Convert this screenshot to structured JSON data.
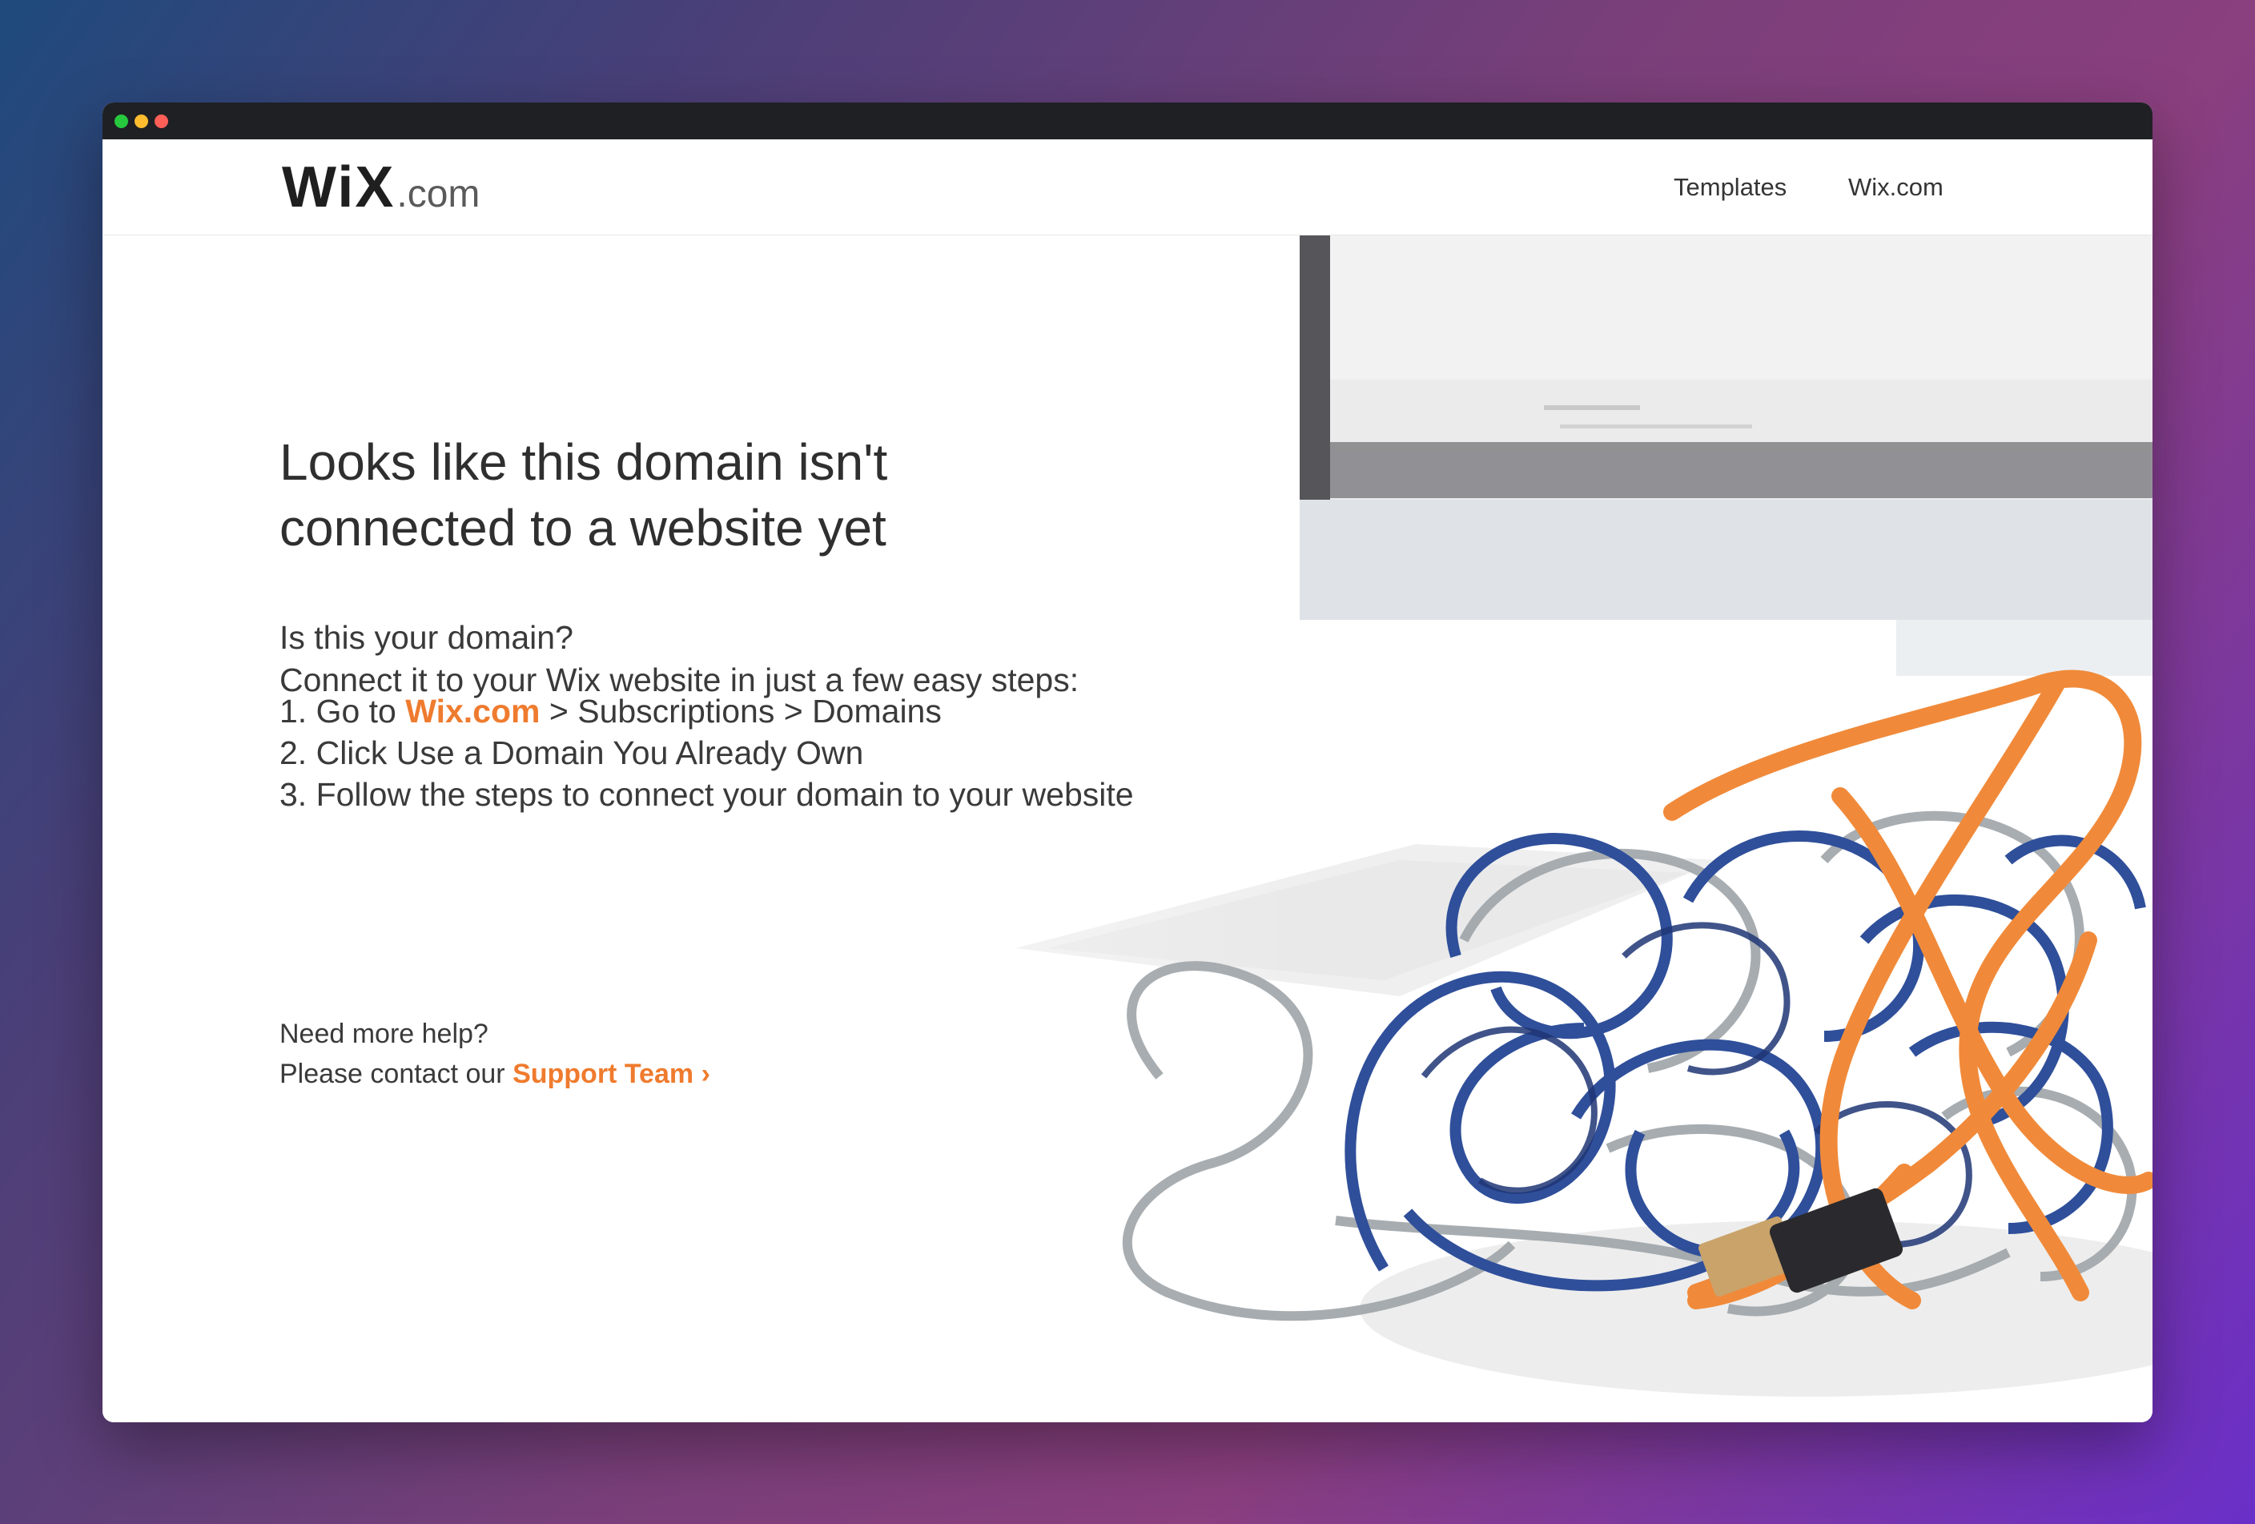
{
  "window": {
    "controls": [
      "green",
      "yellow",
      "red"
    ]
  },
  "header": {
    "logo_wordmark": "WiX",
    "logo_suffix": ".com",
    "nav": [
      {
        "label": "Templates"
      },
      {
        "label": "Wix.com"
      }
    ]
  },
  "main": {
    "headline_line1": "Looks like this domain isn't",
    "headline_line2": "connected to a website yet",
    "intro_line1": "Is this your domain?",
    "intro_line2": "Connect it to your Wix website in just a few easy steps:",
    "step1_prefix": "1. Go to ",
    "step1_link": "Wix.com",
    "step1_suffix": " > Subscriptions > Domains",
    "step2": "2. Click Use a Domain You Already Own",
    "step3": "3. Follow the steps to connect your domain to your website",
    "help_line1": "Need more help?",
    "help_prefix": "Please contact our ",
    "support_link": "Support Team",
    "support_chevron": "›"
  },
  "colors": {
    "accent": "#ef7b2e",
    "text": "#2f2f2f",
    "titlebar": "#1f2024"
  },
  "icons": {
    "window_dots": "traffic-light-dots",
    "chevron": "chevron-right-icon"
  }
}
